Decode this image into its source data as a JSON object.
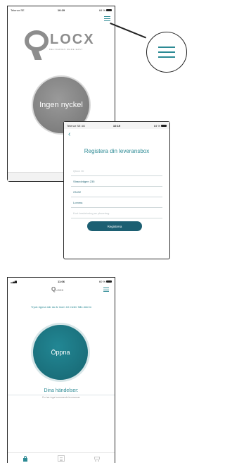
{
  "screen_one": {
    "status": {
      "carrier": "Telenor SE",
      "time": "10:19",
      "battery": "84 %"
    },
    "logo": {
      "wordmark": "LOCX",
      "tagline": "DELIVERIES MADE EASY"
    },
    "no_key_label": "Ingen nyckel"
  },
  "screen_two": {
    "status": {
      "carrier": "Telenor SE 4G",
      "time": "10:19",
      "battery": "84 %"
    },
    "back_icon": "chevron-left-icon",
    "title": "Registera din leveransbox",
    "fields": [
      {
        "placeholder": "Qlocx ID",
        "value": ""
      },
      {
        "placeholder": "",
        "value": "Strandvägen 235"
      },
      {
        "placeholder": "",
        "value": "23432"
      },
      {
        "placeholder": "",
        "value": "Lomma"
      },
      {
        "placeholder": "Kort beskrivning av placering",
        "value": ""
      }
    ],
    "register_button": "Registrera"
  },
  "screen_three": {
    "status": {
      "time": "11:06",
      "battery": "60 %"
    },
    "logo": {
      "mark": "Q",
      "wordmark": "LOCX"
    },
    "hint": "Tryck öppna när du är inom 10 meter från dörren",
    "open_button": "Öppna",
    "events_title": "Dina händelser:",
    "events_empty": "Du har inga kommande leveranser"
  },
  "colors": {
    "accent": "#2c8a94",
    "button_dark": "#1c5f72",
    "inactive_grey": "#8d8d8d"
  }
}
